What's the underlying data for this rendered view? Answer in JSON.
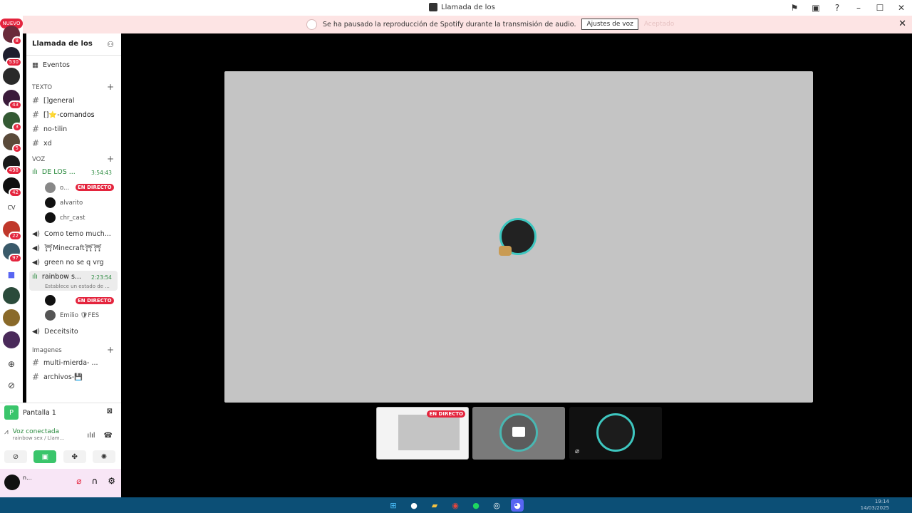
{
  "window": {
    "title": "Llamada de los"
  },
  "notice": {
    "text": "Se ha pausado la reproducción de Spotify durante la transmisión de audio.",
    "button": "Ajustes de voz",
    "link": "Aceptado",
    "close": "✕"
  },
  "guilds": {
    "nuevo": "NUEVO",
    "badges": [
      "8",
      "530",
      "43",
      "3",
      "5",
      "498",
      "42",
      "22",
      "97"
    ],
    "cv_label": "CV"
  },
  "server": {
    "name": "Llamada de los",
    "events": "Eventos",
    "text_category": "TEXTO",
    "text_channels": [
      "[]general",
      "[]⭐-comandos",
      "no-tilin",
      "xd"
    ],
    "voice_category": "VOZ",
    "voice_channels": {
      "active1": {
        "name": "DE LOS ...",
        "duration": "3:54:43"
      },
      "users1": [
        {
          "name": "o...",
          "live": "EN DIRECTO"
        },
        {
          "name": "alvarito"
        },
        {
          "name": "chr_cast"
        }
      ],
      "other": [
        "Como temo much...",
        "⛩Minecraft⛩⛩",
        "green no se q vrg"
      ],
      "active2": {
        "name": "rainbow s...",
        "duration": "2:23:54",
        "status": "Establece un estado de ..."
      },
      "users2": [
        {
          "name": "",
          "live": "EN DIRECTO"
        },
        {
          "name": "Emilio 🛡FES"
        }
      ],
      "last": "Deceitsito"
    },
    "images_category": "Imagenes",
    "image_channels": [
      "multi-mierda- ...",
      "archivos-💾"
    ]
  },
  "panel": {
    "screen_letter": "P",
    "screen_label": "Pantalla 1",
    "voice_status": "Voz conectada",
    "voice_sub": "rainbow sex / Llam...",
    "user_name": "n..."
  },
  "stage": {
    "live_badge": "EN DIRECTO"
  },
  "taskbar": {
    "time": "19:14",
    "date": "14/03/2025"
  },
  "colors": {
    "live": "#e4243d",
    "voice_green": "#2a8a3e",
    "ring": "#3ec7c0",
    "notice_bg": "#fde4e4",
    "taskbar": "#0c4f76"
  }
}
